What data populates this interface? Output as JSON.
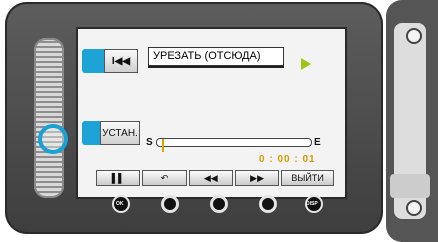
{
  "screen": {
    "top_button_icon": "skip-back-icon",
    "title": "УРЕЗАТЬ (ОТСЮДА)",
    "set_button_label": "УСТАН.",
    "timeline_start_label": "S",
    "timeline_end_label": "E",
    "marker_position_fraction": 0.02,
    "timecode": "0 : 00 : 01",
    "accent_color": "#1ea3d6"
  },
  "controls": [
    {
      "icon": "pause-icon",
      "label": "▌▌"
    },
    {
      "icon": "undo-icon",
      "label": "↶"
    },
    {
      "icon": "rewind-icon",
      "label": "◀◀"
    },
    {
      "icon": "fast-forward-icon",
      "label": "▶▶"
    },
    {
      "icon": "exit",
      "label": "ВЫЙТИ"
    }
  ],
  "hardware_buttons": {
    "ok_label": "OK",
    "disp_label": "DISP"
  }
}
